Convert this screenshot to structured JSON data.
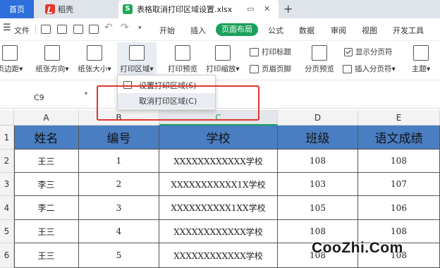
{
  "tabs": {
    "home": "首页",
    "daoke": "稻壳",
    "file": "表格取消打印区域设置.xlsx",
    "new_tab": "+"
  },
  "menu": {
    "file": "文件",
    "items": [
      "开始",
      "插入",
      "页面布局",
      "公式",
      "数据",
      "审阅",
      "视图",
      "开发工具"
    ],
    "active": "页面布局"
  },
  "ribbon": {
    "margins": "页边距",
    "orientation": "纸张方向",
    "size": "纸张大小",
    "print_area": "打印区域",
    "print_preview": "打印预览",
    "print_scale": "打印缩放",
    "print_titles": "打印标题",
    "header_footer": "页眉页脚",
    "page_break_preview": "分页预览",
    "show_page_breaks": "显示分页符",
    "insert_page_break": "插入分页符",
    "theme": "主题",
    "caret": "▾"
  },
  "name_box": "C9",
  "dropdown": {
    "set_print_area": "设置打印区域(S)",
    "cancel_print_area": "取消打印区域(C)"
  },
  "columns": [
    "A",
    "B",
    "C",
    "D",
    "E"
  ],
  "selected_column": "C",
  "row_numbers": [
    "1",
    "2",
    "3",
    "4",
    "5",
    "6"
  ],
  "table": {
    "headers": [
      "姓名",
      "编号",
      "学校",
      "班级",
      "语文成绩"
    ],
    "rows": [
      [
        "王三",
        "1",
        "XXXXXXXXXXXX学校",
        "108",
        "108"
      ],
      [
        "李三",
        "2",
        "XXXXXXXXXXX1X学校",
        "103",
        "107"
      ],
      [
        "李二",
        "3",
        "XXXXXXXXXX1XX学校",
        "105",
        "106"
      ],
      [
        "王三",
        "4",
        "XXXXXXXXXXXX学校",
        "108",
        "108"
      ],
      [
        "王三",
        "5",
        "XXXXXXXXXXXX学校",
        "108",
        "108"
      ]
    ]
  },
  "watermark": "CooZhi.Com",
  "colors": {
    "accent": "#1aa05a",
    "header_fill": "#4a7ec2",
    "highlight": "#e0342f",
    "tab_blue": "#2f6fdb"
  }
}
